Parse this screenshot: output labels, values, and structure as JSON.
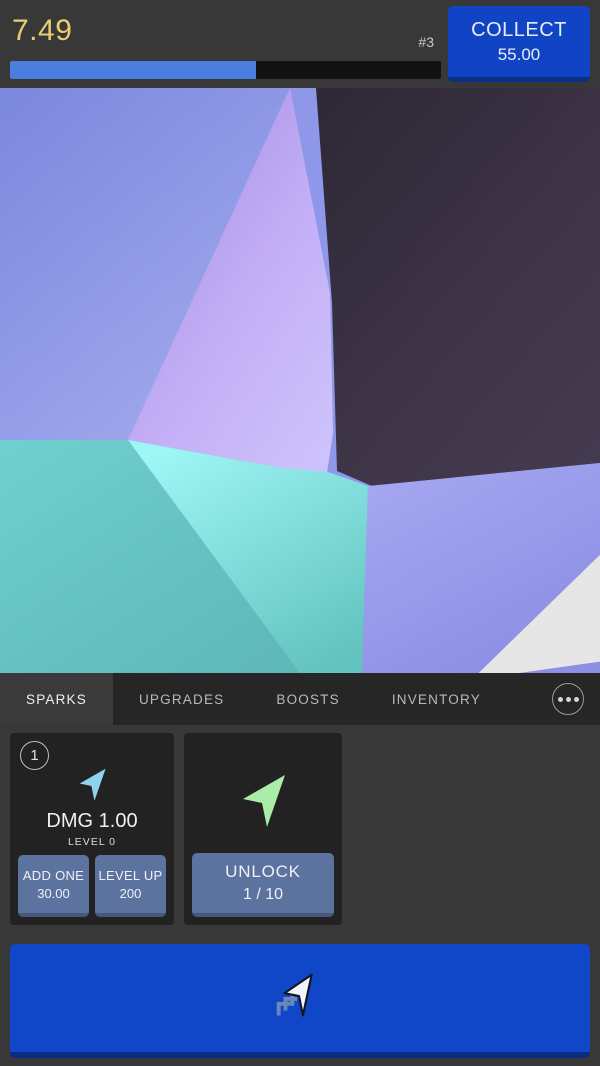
{
  "hud": {
    "score": "7.49",
    "rank": "#3",
    "progress_percent": 57,
    "collect_label": "COLLECT",
    "collect_value": "55.00"
  },
  "game": {
    "cursor_icon": "arrow-cursor-icon",
    "colors": {
      "dark_cell": "#3a3142",
      "periwinkle": "#8e97e8",
      "lavender": "#b9a7f0",
      "teal": "#6bc6c6",
      "cyan": "#86f0f0"
    }
  },
  "tabs": [
    {
      "label": "SPARKS",
      "active": true
    },
    {
      "label": "UPGRADES",
      "active": false
    },
    {
      "label": "BOOSTS",
      "active": false
    },
    {
      "label": "INVENTORY",
      "active": false
    }
  ],
  "more_button": {
    "icon": "ellipsis-icon"
  },
  "cards": [
    {
      "badge": "1",
      "icon": "arrow-spark-icon",
      "icon_color": "#8fd3f0",
      "dmg_label": "DMG 1.00",
      "level_label": "LEVEL 0",
      "buttons": [
        {
          "title": "ADD ONE",
          "value": "30.00"
        },
        {
          "title": "LEVEL UP",
          "value": "200"
        }
      ]
    },
    {
      "badge": "",
      "icon": "arrow-spark-icon",
      "icon_color": "#a9eda9",
      "dmg_label": "",
      "level_label": "",
      "buttons": [
        {
          "title": "UNLOCK",
          "value": "1 / 10"
        }
      ]
    }
  ],
  "action_button": {
    "icon": "click-cursor-icon",
    "label": ""
  },
  "theme": {
    "accent_blue": "#1047c8",
    "button_blue": "#5d739f",
    "gold": "#e9cd72",
    "panel_dark": "#222222",
    "app_bg": "#383838",
    "tabbar_bg": "#262626"
  }
}
